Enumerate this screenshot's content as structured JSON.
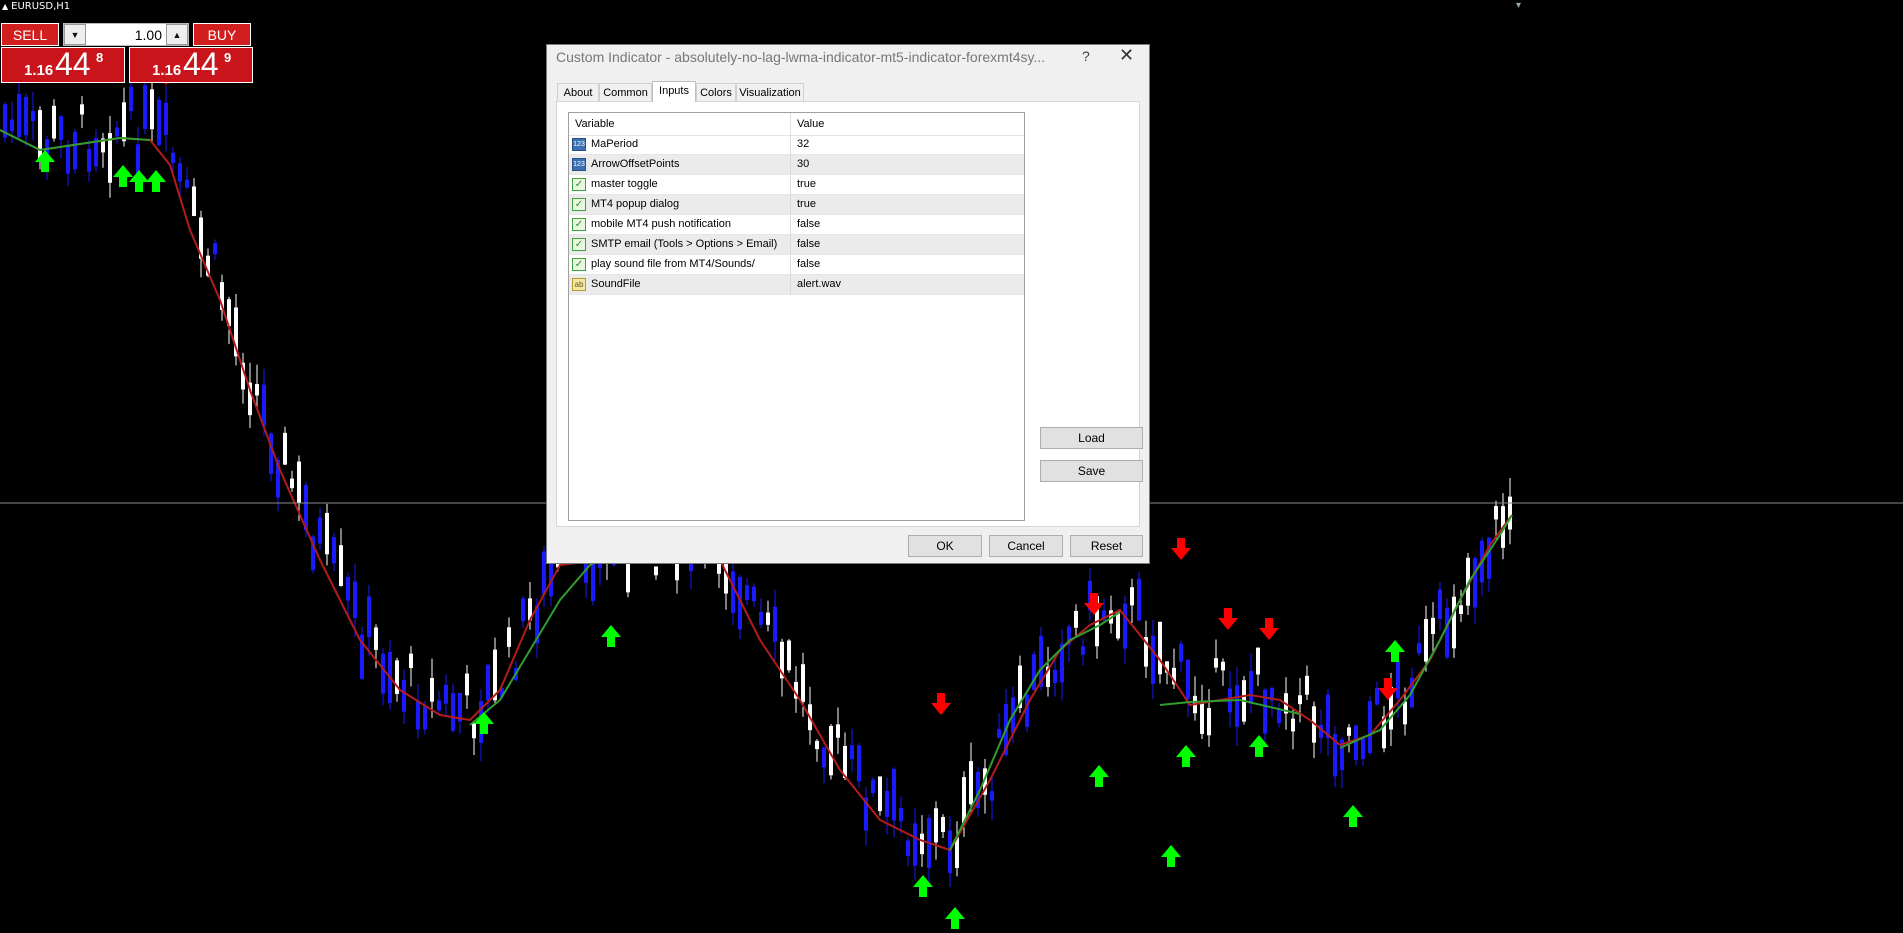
{
  "chart": {
    "symbol_label": "EURUSD,H1",
    "colors": {
      "bull_candle": "#ffffff",
      "bear_candle": "#1a1aff",
      "ma_down": "#b31c1c",
      "ma_up": "#2e9e2e",
      "arrow_up": "#00ff00",
      "arrow_down": "#ff0000"
    }
  },
  "trade_panel": {
    "sell_label": "SELL",
    "buy_label": "BUY",
    "lot_value": "1.00",
    "sell_price": {
      "prefix": "1.16",
      "big": "44",
      "sup": "8"
    },
    "buy_price": {
      "prefix": "1.16",
      "big": "44",
      "sup": "9"
    }
  },
  "dialog": {
    "title": "Custom Indicator - absolutely-no-lag-lwma-indicator-mt5-indicator-forexmt4sy...",
    "help_label": "?",
    "close_label": "✕",
    "tabs": [
      {
        "label": "About"
      },
      {
        "label": "Common"
      },
      {
        "label": "Inputs"
      },
      {
        "label": "Colors"
      },
      {
        "label": "Visualization"
      }
    ],
    "active_tab": "Inputs",
    "grid": {
      "col_variable": "Variable",
      "col_value": "Value",
      "rows": [
        {
          "icon": "int-icon",
          "icon_text": "123",
          "name": "MaPeriod",
          "value": "32"
        },
        {
          "icon": "int-icon",
          "icon_text": "123",
          "name": "ArrowOffsetPoints",
          "value": "30"
        },
        {
          "icon": "bool-icon",
          "icon_text": "✓",
          "name": "master toggle",
          "value": "true"
        },
        {
          "icon": "bool-icon",
          "icon_text": "✓",
          "name": "MT4 popup dialog",
          "value": "true"
        },
        {
          "icon": "bool-icon",
          "icon_text": "✓",
          "name": "mobile MT4 push notification",
          "value": "false"
        },
        {
          "icon": "bool-icon",
          "icon_text": "✓",
          "name": "SMTP email (Tools > Options > Email)",
          "value": "false"
        },
        {
          "icon": "bool-icon",
          "icon_text": "✓",
          "name": "play sound file from MT4/Sounds/",
          "value": "false"
        },
        {
          "icon": "string-icon",
          "icon_text": "ab",
          "name": "SoundFile",
          "value": "alert.wav"
        }
      ]
    },
    "load_label": "Load",
    "save_label": "Save",
    "ok_label": "OK",
    "cancel_label": "Cancel",
    "reset_label": "Reset"
  }
}
